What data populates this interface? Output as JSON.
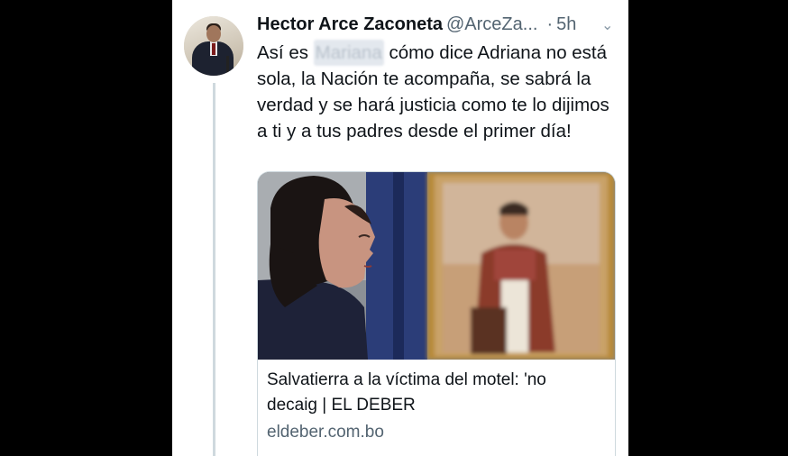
{
  "tweet": {
    "author_name": "Hector Arce Zaconeta",
    "author_handle": "@ArceZa...",
    "separator": "·",
    "timestamp": "5h",
    "menu_icon": "chevron-down-icon",
    "text_before": "Así es",
    "text_redacted": "Mariana",
    "text_after": "cómo dice Adriana no está sola, la Nación te acompaña, se sabrá la verdad y se hará justicia como te lo dijimos a ti y a tus padres desde el primer día!"
  },
  "link_card": {
    "title": "Salvatierra a la víctima del motel: 'no decaig | EL DEBER",
    "domain": "eldeber.com.bo"
  },
  "colors": {
    "background": "#000000",
    "card_border": "#cfd9de",
    "secondary_text": "#536471",
    "primary_text": "#0f1419"
  }
}
